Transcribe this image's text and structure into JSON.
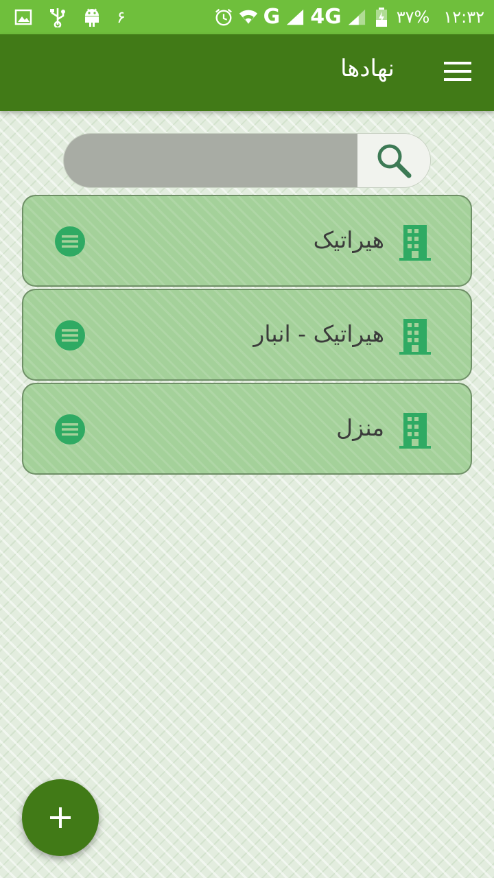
{
  "status_bar": {
    "notification_count": "۶",
    "network_g": "G",
    "network_4g": "4G",
    "battery_percent": "۳۷%",
    "time": "۱۲:۳۲"
  },
  "app_bar": {
    "title": "نهادها",
    "menu_icon": "hamburger-menu-icon"
  },
  "search": {
    "placeholder": "",
    "value": "",
    "icon": "search-icon"
  },
  "organizations": [
    {
      "name": "هیراتیک",
      "icon": "building-icon",
      "menu_icon": "list-menu-icon"
    },
    {
      "name": "هیراتیک - انبار",
      "icon": "building-icon",
      "menu_icon": "list-menu-icon"
    },
    {
      "name": "منزل",
      "icon": "building-icon",
      "menu_icon": "list-menu-icon"
    }
  ],
  "fab": {
    "icon": "plus-icon"
  },
  "colors": {
    "status_bar": "#6fbf3c",
    "app_bar": "#417a17",
    "card": "#a4d19a",
    "icon_green": "#2faa63"
  }
}
